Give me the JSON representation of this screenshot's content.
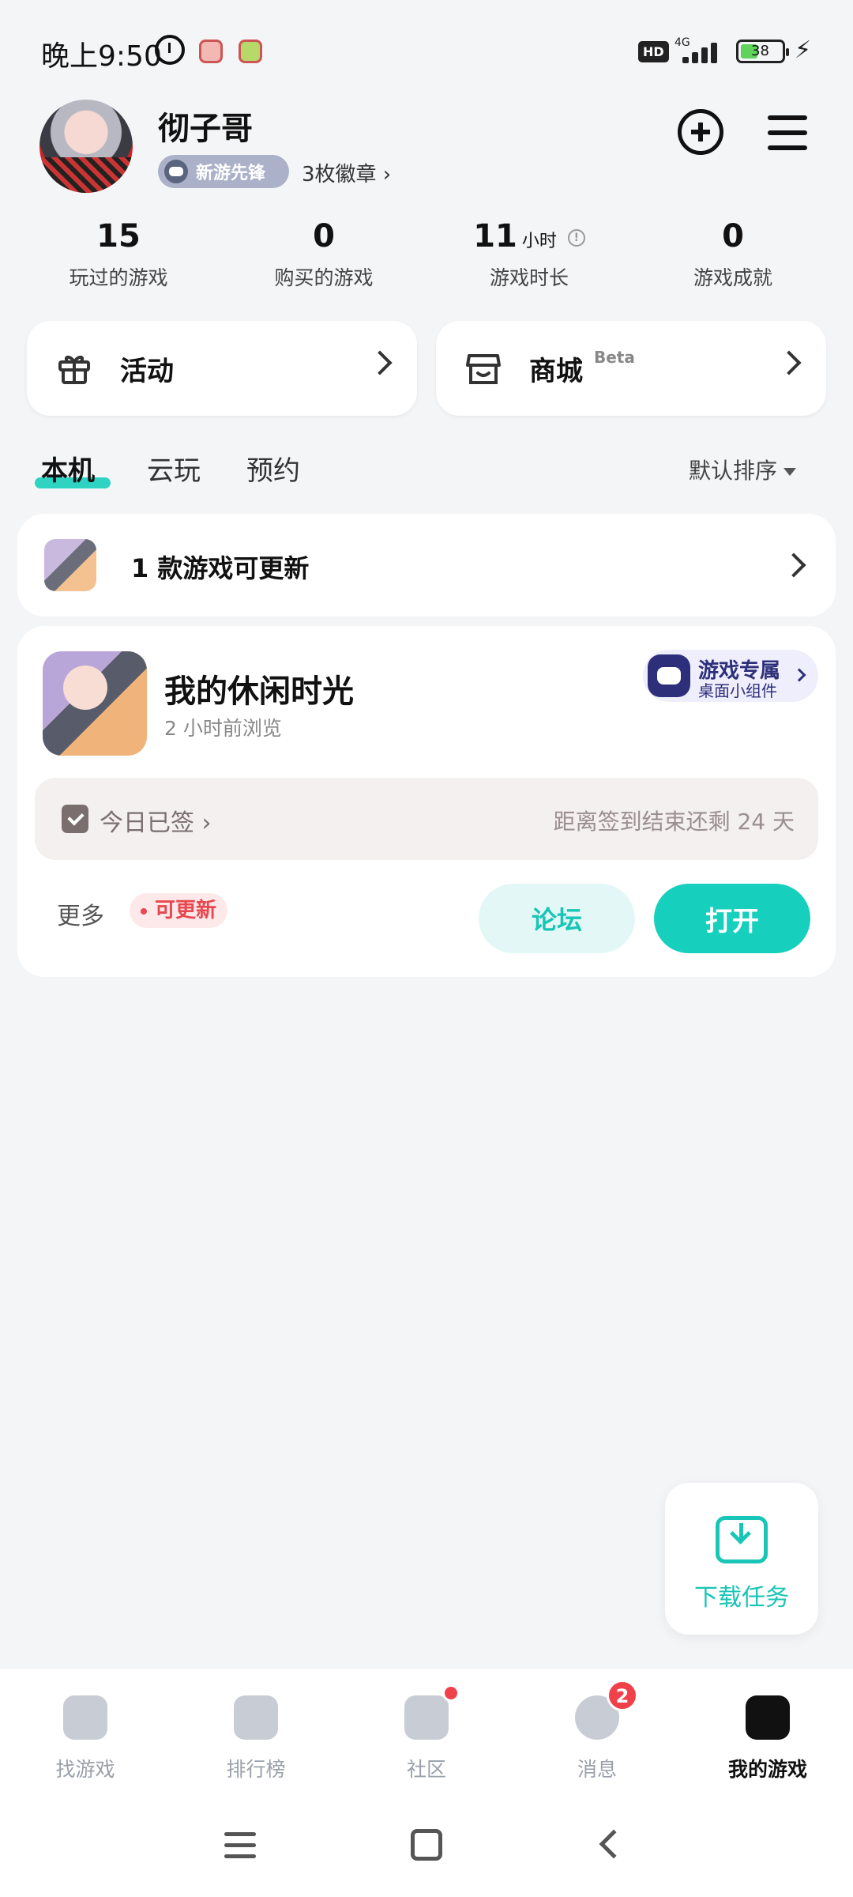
{
  "status_bar": {
    "time": "晚上9:50",
    "hd": "HD",
    "network": "4G",
    "battery": "38"
  },
  "profile": {
    "username": "彻子哥",
    "badge_label": "新游先锋",
    "badges_count": "3枚徽章 ›"
  },
  "stats": [
    {
      "value": "15",
      "unit": "",
      "label": "玩过的游戏"
    },
    {
      "value": "0",
      "unit": "",
      "label": "购买的游戏"
    },
    {
      "value": "11",
      "unit": "小时",
      "label": "游戏时长"
    },
    {
      "value": "0",
      "unit": "",
      "label": "游戏成就"
    }
  ],
  "cards": {
    "activity": {
      "label": "活动"
    },
    "shop": {
      "label": "商城",
      "tag": "Beta"
    }
  },
  "tabs": [
    "本机",
    "云玩",
    "预约"
  ],
  "sort_label": "默认排序",
  "update_row": {
    "text": "1 款游戏可更新"
  },
  "game": {
    "name": "我的休闲时光",
    "subtitle": "2 小时前浏览",
    "widget_title": "游戏专属",
    "widget_subtitle": "桌面小组件",
    "checkin_label": "今日已签 ›",
    "checkin_remaining": "距离签到结束还剩 24 天",
    "more_label": "更多",
    "update_badge": "可更新",
    "forum_button": "论坛",
    "open_button": "打开"
  },
  "fab": {
    "label": "下载任务"
  },
  "bottom_nav": [
    {
      "label": "找游戏"
    },
    {
      "label": "排行榜"
    },
    {
      "label": "社区"
    },
    {
      "label": "消息",
      "badge": "2"
    },
    {
      "label": "我的游戏"
    }
  ],
  "colors": {
    "accent": "#16cfbd",
    "alert": "#f0414a"
  }
}
